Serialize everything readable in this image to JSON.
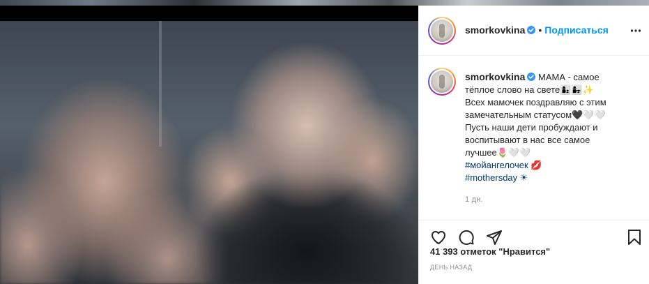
{
  "post": {
    "username": "smorkovkina",
    "dot_separator": "•",
    "follow_label": "Подписаться"
  },
  "caption": {
    "username": "smorkovkina",
    "lines": [
      "МАМА - самое",
      "тёплое слово на свете👩‍👦👩‍👧✨",
      "Всех мамочек поздравляю с этим",
      "замечательным статусом🖤🤍🤍",
      "Пусть наши дети пробуждают и",
      "воспитывают в нас все самое",
      "лучшее🌷🤍🤍"
    ],
    "hashtags": [
      "#мойангелочек 💋",
      "#mothersday ☀"
    ],
    "time_ago": "1 дн."
  },
  "likes_text": "41 393 отметок \"Нравится\"",
  "posted_ago": "ДЕНЬ НАЗАД",
  "icons": {
    "verified": "verified-badge-icon",
    "more": "more-options-icon",
    "like": "heart-icon",
    "comment": "comment-icon",
    "share": "share-icon",
    "save": "bookmark-icon"
  },
  "colors": {
    "accent": "#0095f6",
    "verified": "#3897f0",
    "hashtag": "#00376b",
    "muted": "#8e8e8e"
  }
}
